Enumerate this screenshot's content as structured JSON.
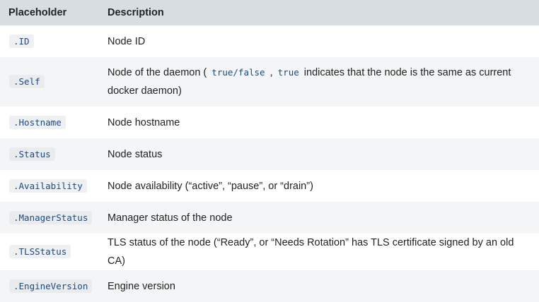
{
  "table": {
    "headers": [
      "Placeholder",
      "Description"
    ],
    "rows": [
      {
        "placeholder": ".ID",
        "description": "Node ID"
      },
      {
        "placeholder": ".Self",
        "description_parts": [
          "Node of the daemon ( ",
          "true/false",
          " , ",
          "true",
          " indicates that the node is the same as current docker daemon)"
        ]
      },
      {
        "placeholder": ".Hostname",
        "description": "Node hostname"
      },
      {
        "placeholder": ".Status",
        "description": "Node status"
      },
      {
        "placeholder": ".Availability",
        "description": "Node availability (“active”, “pause”, or “drain”)"
      },
      {
        "placeholder": ".ManagerStatus",
        "description": "Manager status of the node"
      },
      {
        "placeholder": ".TLSStatus",
        "description": "TLS status of the node (“Ready”, or “Needs Rotation” has TLS certificate signed by an old CA)"
      },
      {
        "placeholder": ".EngineVersion",
        "description": "Engine version"
      }
    ]
  },
  "colors": {
    "header_bg": "#d8dde1",
    "stripe_bg": "#f4f5f6",
    "code_text": "#1a4a86"
  }
}
